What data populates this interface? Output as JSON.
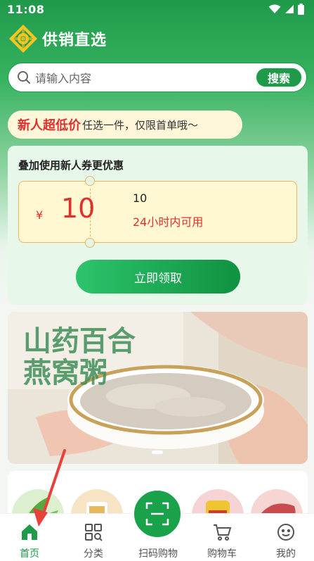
{
  "status_bar": {
    "time": "11:08"
  },
  "brand": {
    "name": "供销直选"
  },
  "search": {
    "placeholder": "请输入内容",
    "button": "搜索"
  },
  "promo": {
    "highlight": "新人超低价",
    "text": "任选一件，仅限首单哦～"
  },
  "coupon": {
    "title": "叠加使用新人券更优惠",
    "currency": "¥",
    "amount": "10",
    "min_spend": "10",
    "validity": "24小时内可用",
    "claim_button": "立即领取"
  },
  "banner": {
    "caption": "山药百合燕窝粥"
  },
  "tabs": [
    {
      "label": "首页",
      "icon": "home-icon",
      "active": true
    },
    {
      "label": "分类",
      "icon": "category-icon",
      "active": false
    },
    {
      "label": "扫码购物",
      "icon": "scan-icon",
      "active": false
    },
    {
      "label": "购物车",
      "icon": "cart-icon",
      "active": false
    },
    {
      "label": "我的",
      "icon": "profile-icon",
      "active": false
    }
  ],
  "colors": {
    "brand_green": "#1f9a4a",
    "price_red": "#e0302b",
    "coupon_bg": "#fff8d2"
  }
}
